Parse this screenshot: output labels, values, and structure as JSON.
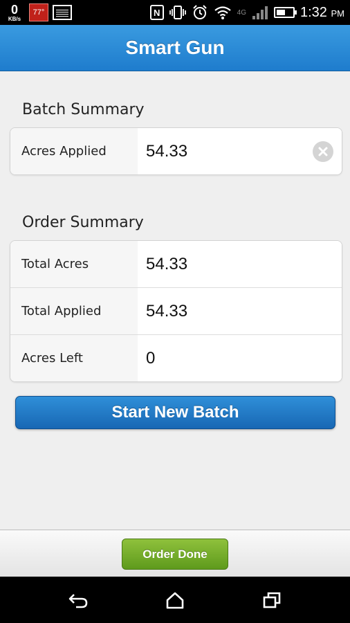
{
  "status_bar": {
    "net_speed": "0",
    "net_unit": "KB/s",
    "temperature": "77°",
    "network_type": "4G",
    "time": "1:32",
    "ampm": "PM",
    "icons": [
      "image-icon",
      "nfc-icon",
      "vibrate-icon",
      "alarm-icon",
      "wifi-icon",
      "signal-icon",
      "battery-icon"
    ]
  },
  "header": {
    "title": "Smart Gun"
  },
  "batch_summary": {
    "title": "Batch Summary",
    "rows": [
      {
        "label": "Acres Applied",
        "value": "54.33"
      }
    ]
  },
  "order_summary": {
    "title": "Order Summary",
    "rows": [
      {
        "label": "Total Acres",
        "value": "54.33"
      },
      {
        "label": "Total Applied",
        "value": "54.33"
      },
      {
        "label": "Acres Left",
        "value": "0"
      }
    ]
  },
  "actions": {
    "start_new_batch": "Start New Batch",
    "order_done": "Order Done"
  },
  "colors": {
    "header": "#2a8ad6",
    "primary_button": "#1f74c3",
    "done_button": "#6fa826",
    "temperature_badge": "#c0211a"
  }
}
